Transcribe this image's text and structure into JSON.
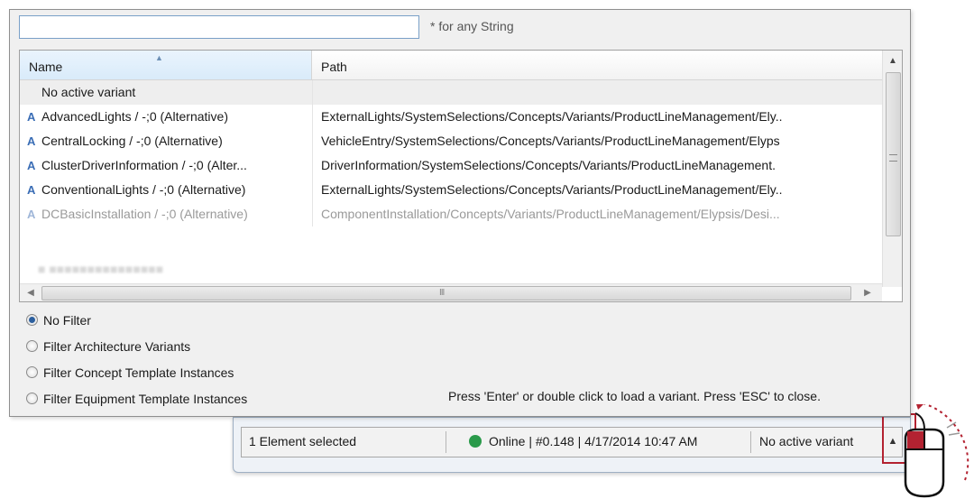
{
  "search": {
    "value": "",
    "hint": "* for any String"
  },
  "table": {
    "columns": {
      "name": "Name",
      "path": "Path"
    },
    "rows": [
      {
        "name": "No active variant",
        "path": ""
      },
      {
        "name": "AdvancedLights / -;0 (Alternative)",
        "path": "ExternalLights/SystemSelections/Concepts/Variants/ProductLineManagement/Ely.."
      },
      {
        "name": "CentralLocking / -;0 (Alternative)",
        "path": "VehicleEntry/SystemSelections/Concepts/Variants/ProductLineManagement/Elyps"
      },
      {
        "name": "ClusterDriverInformation / -;0 (Alter...",
        "path": "DriverInformation/SystemSelections/Concepts/Variants/ProductLineManagement."
      },
      {
        "name": "ConventionalLights / -;0 (Alternative)",
        "path": "ExternalLights/SystemSelections/Concepts/Variants/ProductLineManagement/Ely.."
      },
      {
        "name": "DCBasicInstallation / -;0 (Alternative)",
        "path": "ComponentInstallation/Concepts/Variants/ProductLineManagement/Elypsis/Desi..."
      }
    ],
    "hscroll_grip": "III"
  },
  "filters": [
    {
      "label": "No Filter",
      "selected": true
    },
    {
      "label": "Filter Architecture Variants",
      "selected": false
    },
    {
      "label": "Filter Concept Template Instances",
      "selected": false
    },
    {
      "label": "Filter Equipment Template Instances",
      "selected": false
    }
  ],
  "footer_hint": "Press 'Enter' or double click to load a variant. Press 'ESC' to close.",
  "statusbar": {
    "selection": "1 Element selected",
    "online": "Online | #0.148 | 4/17/2014 10:47 AM",
    "variant": "No active variant"
  },
  "icons": {
    "variant": "variant-icon",
    "status": "online-status-dot",
    "mouse": "mouse-double-click-icon"
  },
  "colors": {
    "online": "#2a9a4a",
    "highlight": "#b32231",
    "variant_icon": "#3a6db5"
  }
}
